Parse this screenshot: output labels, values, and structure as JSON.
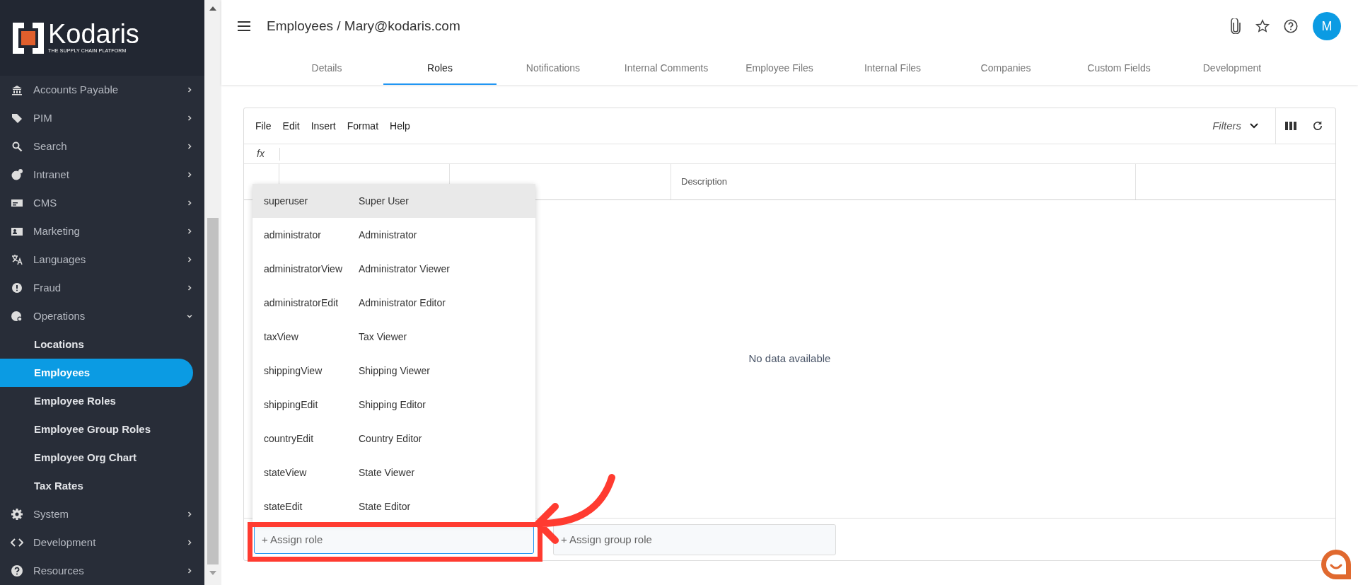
{
  "logo": {
    "name": "Kodaris",
    "tagline": "THE SUPPLY CHAIN PLATFORM"
  },
  "sidebar": {
    "items": [
      {
        "label": "Accounts Payable",
        "expanded": false
      },
      {
        "label": "PIM",
        "expanded": false
      },
      {
        "label": "Search",
        "expanded": false
      },
      {
        "label": "Intranet",
        "expanded": false
      },
      {
        "label": "CMS",
        "expanded": false
      },
      {
        "label": "Marketing",
        "expanded": false
      },
      {
        "label": "Languages",
        "expanded": false
      },
      {
        "label": "Fraud",
        "expanded": false
      },
      {
        "label": "Operations",
        "expanded": true,
        "children": [
          {
            "label": "Locations",
            "selected": false
          },
          {
            "label": "Employees",
            "selected": true
          },
          {
            "label": "Employee Roles",
            "selected": false
          },
          {
            "label": "Employee Group Roles",
            "selected": false
          },
          {
            "label": "Employee Org Chart",
            "selected": false
          },
          {
            "label": "Tax Rates",
            "selected": false
          }
        ]
      },
      {
        "label": "System",
        "expanded": false
      },
      {
        "label": "Development",
        "expanded": false
      },
      {
        "label": "Resources",
        "expanded": false
      }
    ]
  },
  "header": {
    "title": "Employees / Mary@kodaris.com",
    "avatar": "M"
  },
  "tabs": [
    {
      "label": "Details",
      "selected": false
    },
    {
      "label": "Roles",
      "selected": true
    },
    {
      "label": "Notifications",
      "selected": false
    },
    {
      "label": "Internal Comments",
      "selected": false
    },
    {
      "label": "Employee Files",
      "selected": false
    },
    {
      "label": "Internal Files",
      "selected": false
    },
    {
      "label": "Companies",
      "selected": false
    },
    {
      "label": "Custom Fields",
      "selected": false
    },
    {
      "label": "Development",
      "selected": false
    }
  ],
  "grid": {
    "menu": [
      "File",
      "Edit",
      "Insert",
      "Format",
      "Help"
    ],
    "filters": "Filters",
    "formula_label": "fx",
    "columns": [
      "Description"
    ],
    "empty_text": "No data available"
  },
  "role_dropdown": {
    "options": [
      {
        "code": "superuser",
        "name": "Super User",
        "selected": true
      },
      {
        "code": "administrator",
        "name": "Administrator",
        "selected": false
      },
      {
        "code": "administratorView",
        "name": "Administrator Viewer",
        "selected": false
      },
      {
        "code": "administratorEdit",
        "name": "Administrator Editor",
        "selected": false
      },
      {
        "code": "taxView",
        "name": "Tax Viewer",
        "selected": false
      },
      {
        "code": "shippingView",
        "name": "Shipping Viewer",
        "selected": false
      },
      {
        "code": "shippingEdit",
        "name": "Shipping Editor",
        "selected": false
      },
      {
        "code": "countryEdit",
        "name": "Country Editor",
        "selected": false
      },
      {
        "code": "stateView",
        "name": "State Viewer",
        "selected": false
      },
      {
        "code": "stateEdit",
        "name": "State Editor",
        "selected": false
      }
    ]
  },
  "assign_role": {
    "placeholder": "+ Assign role"
  },
  "assign_group_role": {
    "placeholder": "+ Assign group role"
  }
}
